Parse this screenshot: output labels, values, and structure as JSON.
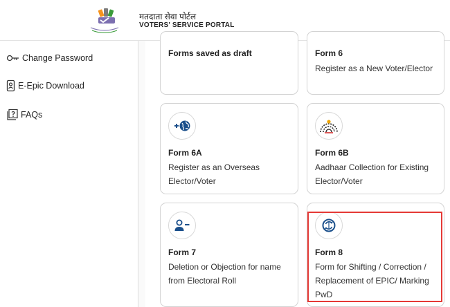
{
  "header": {
    "title_hi": "मतदाता सेवा पोर्टल",
    "title_en": "VOTERS' SERVICE PORTAL"
  },
  "sidebar": {
    "items": [
      {
        "label": "Change Password",
        "icon": "key-icon"
      },
      {
        "label": "E-Epic Download",
        "icon": "id-card-icon"
      },
      {
        "label": "FAQs",
        "icon": "faq-icon"
      }
    ]
  },
  "cards": [
    {
      "title": "Forms saved as draft",
      "desc": ""
    },
    {
      "title": "Form 6",
      "desc": "Register as a New Voter/Elector"
    },
    {
      "title": "Form 6A",
      "desc": "Register as an Overseas Elector/Voter",
      "icon": "globe-plus-icon"
    },
    {
      "title": "Form 6B",
      "desc": "Aadhaar Collection for Existing Elector/Voter",
      "icon": "aadhaar-icon"
    },
    {
      "title": "Form 7",
      "desc": "Deletion or Objection for name from Electoral Roll",
      "icon": "user-minus-icon"
    },
    {
      "title": "Form 8",
      "desc": "Form for Shifting / Correction / Replacement of EPIC/ Marking PwD",
      "icon": "shift-correction-icon"
    }
  ],
  "colors": {
    "accent_blue": "#1a4f8b",
    "highlight_red": "#e53935",
    "border_gray": "#d3d3d3"
  }
}
